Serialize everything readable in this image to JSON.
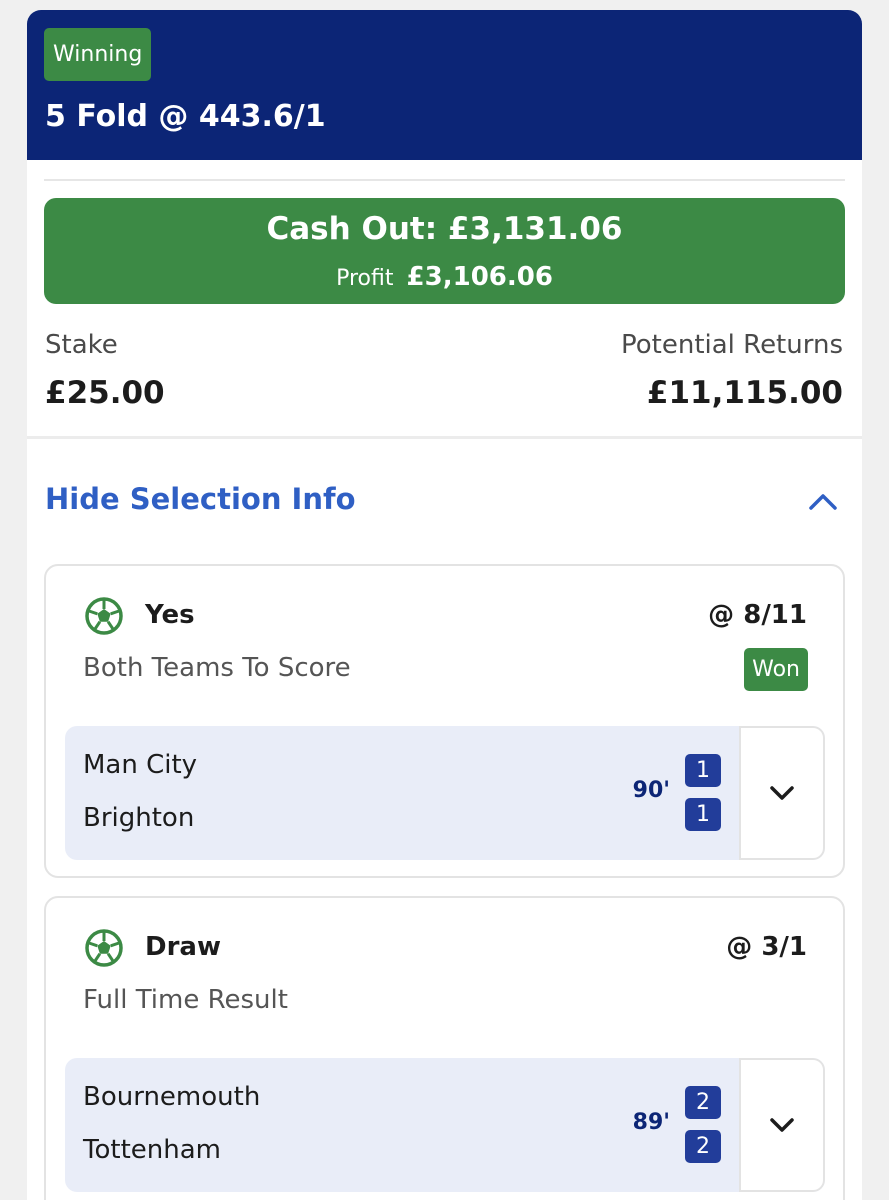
{
  "bet": {
    "status": "Winning",
    "title": "5 Fold @ 443.6/1"
  },
  "cashout": {
    "label": "Cash Out: £3,131.06",
    "profit_label": "Profit",
    "profit_value": "£3,106.06"
  },
  "stake": {
    "label": "Stake",
    "value": "£25.00"
  },
  "returns": {
    "label": "Potential Returns",
    "value": "£11,115.00"
  },
  "selection_toggle": {
    "label": "Hide Selection Info"
  },
  "selections": [
    {
      "name": "Yes",
      "odds": "@ 8/11",
      "market": "Both Teams To Score",
      "result": "Won",
      "home_team": "Man City",
      "away_team": "Brighton",
      "time": "90'",
      "home_score": "1",
      "away_score": "1"
    },
    {
      "name": "Draw",
      "odds": "@ 3/1",
      "market": "Full Time Result",
      "home_team": "Bournemouth",
      "away_team": "Tottenham",
      "time": "89'",
      "home_score": "2",
      "away_score": "2"
    }
  ],
  "icons": {
    "sport": "football-icon",
    "collapse": "chevron-up-icon",
    "expand": "chevron-down-icon"
  },
  "colors": {
    "header": "#0c2576",
    "success": "#3c8a45",
    "link": "#2f5fc4",
    "score_badge": "#223d9a"
  }
}
